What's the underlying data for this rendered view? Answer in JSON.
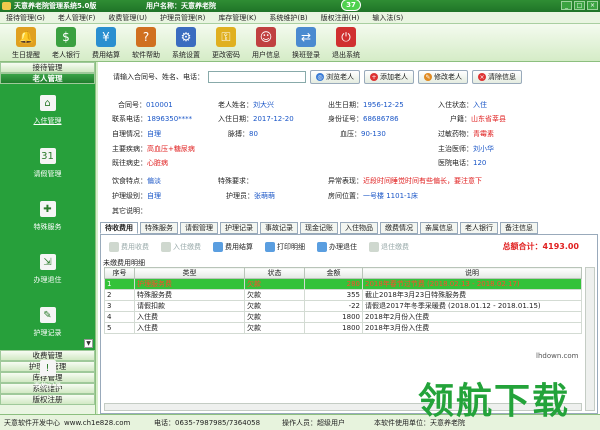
{
  "titlebar": {
    "app": "天意养老院管理系统5.0版",
    "user": "用户名称：天意养老院",
    "badge": "37"
  },
  "menu": [
    "接待管理(G)",
    "老人管理(F)",
    "收费管理(U)",
    "护理员管理(R)",
    "库存管理(K)",
    "系统维护(B)",
    "版权注册(H)",
    "输入法(S)"
  ],
  "toolbar": [
    {
      "label": "生日提醒",
      "icon": "bell-icon",
      "color": "#e0a020"
    },
    {
      "label": "老人银行",
      "icon": "bank-icon",
      "color": "#3aa040"
    },
    {
      "label": "费用结算",
      "icon": "money-icon",
      "color": "#2a8fd0"
    },
    {
      "label": "软件帮助",
      "icon": "help-icon",
      "color": "#d07020"
    },
    {
      "label": "系统设置",
      "icon": "settings-icon",
      "color": "#3a6cc0"
    },
    {
      "label": "更改密码",
      "icon": "key-icon",
      "color": "#e0b020"
    },
    {
      "label": "用户信息",
      "icon": "users-icon",
      "color": "#c04040"
    },
    {
      "label": "换班登录",
      "icon": "login-icon",
      "color": "#4a8ad0"
    },
    {
      "label": "退出系统",
      "icon": "exit-icon",
      "color": "#d03030"
    }
  ],
  "sidebar": {
    "headers_top": [
      "接待管理",
      "老人管理"
    ],
    "items": [
      {
        "label": "入住管理",
        "icon": "checkin-icon",
        "sel": true
      },
      {
        "label": "请假管理",
        "icon": "calendar-icon"
      },
      {
        "label": "特殊服务",
        "icon": "service-icon"
      },
      {
        "label": "办理退住",
        "icon": "checkout-icon"
      },
      {
        "label": "护理记录",
        "icon": "record-icon"
      },
      {
        "label": "事故记录",
        "icon": "accident-icon"
      }
    ],
    "headers_bottom": [
      "收费管理",
      "护理员管理",
      "库存管理",
      "系统维护",
      "版权注册"
    ]
  },
  "search": {
    "label": "请输入合同号、姓名、电话：",
    "placeholder": "",
    "buttons": [
      "浏览老人",
      "添加老人",
      "修改老人",
      "清除信息"
    ]
  },
  "info": {
    "contract_no_k": "合同号：",
    "contract_no": "010001",
    "name_k": "老人姓名：",
    "name": "刘大兴",
    "birth_k": "出生日期：",
    "birth": "1956-12-25",
    "status_k": "入住状态：",
    "status": "入住",
    "phone_k": "联系电话：",
    "phone": "1896350****",
    "checkin_k": "入住日期：",
    "checkin": "2017-12-20",
    "id_k": "身份证号：",
    "id": "68686786",
    "hukou_k": "户籍：",
    "hukou": "山东省莘县",
    "selfcare_k": "自理情况：",
    "selfcare": "自理",
    "pulse_k": "脉搏：",
    "pulse": "80",
    "bp_k": "血压：",
    "bp": "90-130",
    "allergy_k": "过敏药物：",
    "allergy": "青霉素",
    "disease_k": "主要疾病：",
    "disease": "高血压+糖尿病",
    "doctor_k": "主治医师：",
    "doctor": "刘小华",
    "history_k": "既往病史：",
    "history": "心脏病",
    "hosp_phone_k": "医院电话：",
    "hosp_phone": "120",
    "diet_k": "饮食特点：",
    "diet": "偏淡",
    "special_k": "特殊要求：",
    "special": "",
    "abnormal_k": "异常表现：",
    "abnormal": "近段时间睡觉时间有些偏长，要注意下",
    "care_level_k": "护理级别：",
    "care_level": "自理",
    "nurse_k": "护理员：",
    "nurse": "张萌萌",
    "room_k": "房间位置：",
    "room": "一号楼 1101-1床",
    "other_k": "其它说明："
  },
  "tabs": [
    "待收费用",
    "特殊服务",
    "请假管理",
    "护理记录",
    "事故记录",
    "现金记账",
    "入住物品",
    "缴费情况",
    "亲属信息",
    "老人银行",
    "备注信息"
  ],
  "subtoolbar": [
    {
      "label": "费用收费",
      "enabled": false
    },
    {
      "label": "入住缴费",
      "enabled": false
    },
    {
      "label": "费用结算",
      "enabled": true
    },
    {
      "label": "打印明细",
      "enabled": true
    },
    {
      "label": "办理退住",
      "enabled": true
    },
    {
      "label": "退住缴费",
      "enabled": false
    }
  ],
  "total": "总额合计：4193.00",
  "table": {
    "caption": "未缴费用明细",
    "headers": [
      "序号",
      "类型",
      "状态",
      "金额",
      "说明"
    ],
    "rows": [
      [
        "1",
        "护理服务费",
        "欠款",
        "280",
        "2018年春节过节费 (2018.02.13 - 2018.02.17)"
      ],
      [
        "2",
        "特殊服务费",
        "欠款",
        "355",
        "截止2018年3月23日特殊服务费"
      ],
      [
        "3",
        "请假扣款",
        "欠款",
        "-22",
        "请假退2017年冬季采暖费 (2018.01.12 - 2018.01.15)"
      ],
      [
        "4",
        "入住费",
        "欠款",
        "1800",
        "2018年2月份入住费"
      ],
      [
        "5",
        "入住费",
        "欠款",
        "1800",
        "2018年3月份入住费"
      ]
    ]
  },
  "status": {
    "dev": "天意软件开发中心",
    "site": "www.ch1e828.com",
    "phone": "电话：0635-7987985/7364058",
    "operator": "操作人员：超级用户",
    "unit": "本软件使用单位：天意养老院"
  },
  "watermark": {
    "text": "领航下载",
    "site": "lhdown.com"
  }
}
